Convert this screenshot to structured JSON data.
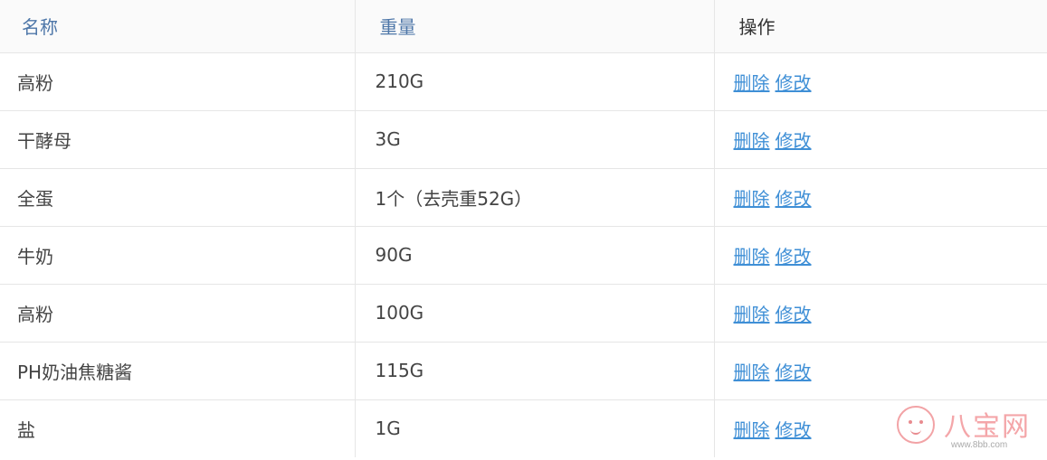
{
  "table": {
    "headers": {
      "name": "名称",
      "weight": "重量",
      "action": "操作"
    },
    "actions": {
      "delete": "删除",
      "edit": "修改"
    },
    "rows": [
      {
        "name": "高粉",
        "weight": "210G"
      },
      {
        "name": "干酵母",
        "weight": "3G"
      },
      {
        "name": "全蛋",
        "weight": "1个（去壳重52G）"
      },
      {
        "name": "牛奶",
        "weight": "90G"
      },
      {
        "name": "高粉",
        "weight": "100G"
      },
      {
        "name": "PH奶油焦糖酱",
        "weight": "115G"
      },
      {
        "name": "盐",
        "weight": "1G"
      }
    ]
  },
  "watermark": {
    "title": "八宝网",
    "url": "www.8bb.com"
  },
  "colors": {
    "header_link": "#4d76a8",
    "action_link": "#3f8fd6",
    "border": "#e6e6e6",
    "watermark": "#f4a6a9"
  }
}
